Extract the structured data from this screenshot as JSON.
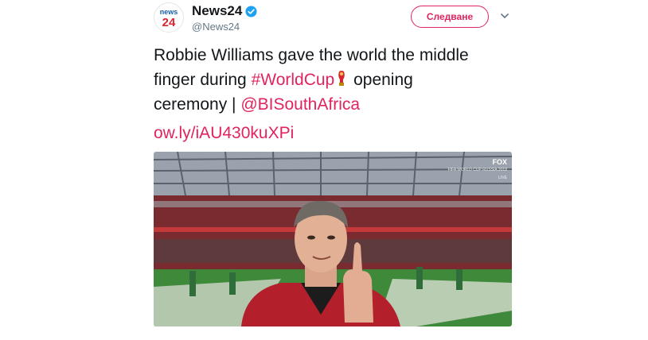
{
  "account": {
    "name": "News24",
    "handle": "@News24",
    "avatar_text": "news",
    "avatar_number": "24",
    "verified": true
  },
  "actions": {
    "follow_label": "Следване"
  },
  "tweet": {
    "text_line1": "Robbie Williams gave the world the middle",
    "text_line2_prefix": "finger during ",
    "hashtag": "#WorldCup",
    "text_line2_suffix": " opening",
    "text_line3_prefix": "ceremony | ",
    "mention": "@BISouthAfrica",
    "url": "ow.ly/iAU430kuXPi"
  },
  "media": {
    "broadcaster": "FOX",
    "overlay_small": "FIFA WORLD CUP RUSSIA 2018",
    "live_label": "LIVE"
  },
  "colors": {
    "accent": "#e0245e",
    "verified": "#1da1f2",
    "text": "#14171a",
    "secondary": "#657786"
  }
}
